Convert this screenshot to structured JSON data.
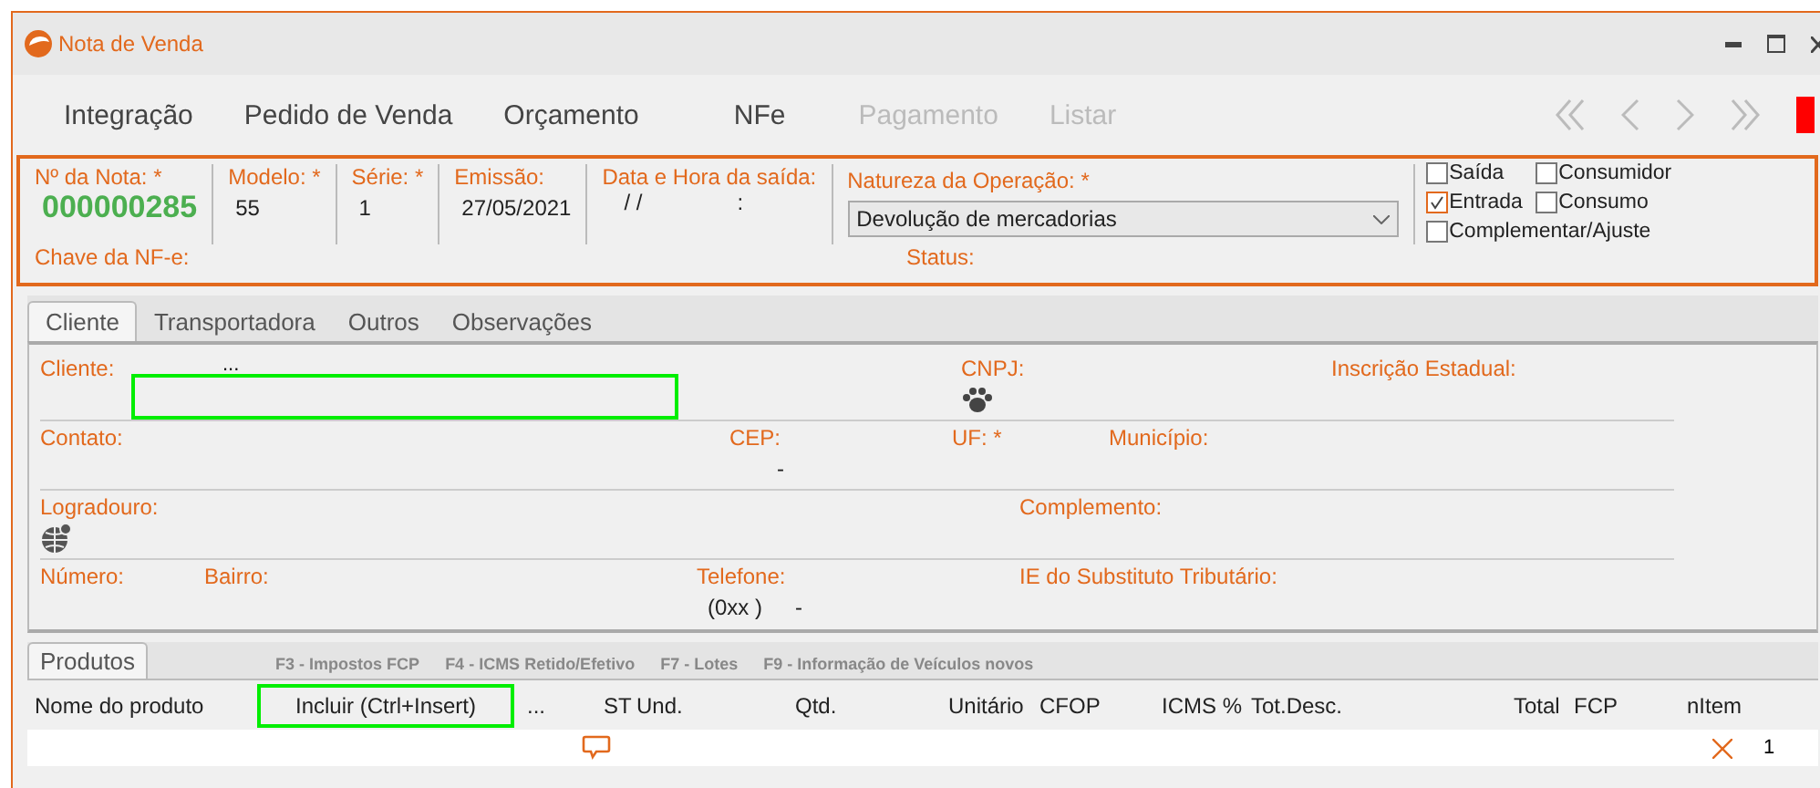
{
  "window": {
    "title": "Nota de Venda"
  },
  "toolbar": {
    "items": [
      {
        "label": "Integração",
        "disabled": false
      },
      {
        "label": "Pedido de Venda",
        "disabled": false
      },
      {
        "label": "Orçamento",
        "disabled": false
      },
      {
        "label": "NFe",
        "disabled": false
      },
      {
        "label": "Pagamento",
        "disabled": true
      },
      {
        "label": "Listar",
        "disabled": true
      }
    ]
  },
  "header": {
    "fields": [
      {
        "label": "Nº da Nota: *",
        "value": "000000285",
        "kind": "number"
      },
      {
        "label": "Modelo: *",
        "value": "55",
        "kind": "text"
      },
      {
        "label": "Série: *",
        "value": "1",
        "kind": "text"
      },
      {
        "label": "Emissão:",
        "value": "27/05/2021",
        "kind": "text"
      },
      {
        "label": "Data e Hora da saída:",
        "value": "/ /",
        "time": ":",
        "kind": "datetime"
      }
    ],
    "operation": {
      "label": "Natureza da Operação: *",
      "value": "Devolução de mercadorias"
    },
    "options": [
      {
        "label": "Saída",
        "checked": false
      },
      {
        "label": "Consumidor",
        "checked": false
      },
      {
        "label": "Entrada",
        "checked": true
      },
      {
        "label": "Consumo",
        "checked": false
      },
      {
        "label": "Complementar/Ajuste",
        "checked": false
      }
    ],
    "chave_label": "Chave da NF-e:",
    "status_label": "Status:"
  },
  "tabs": [
    {
      "label": "Cliente",
      "selected": true
    },
    {
      "label": "Transportadora",
      "selected": false
    },
    {
      "label": "Outros",
      "selected": false
    },
    {
      "label": "Observações",
      "selected": false
    }
  ],
  "client_rows": [
    [
      {
        "label": "Cliente:",
        "kind": "client",
        "value": "...",
        "highlighted": true
      },
      {
        "label": "CNPJ:",
        "kind": "paw"
      },
      {
        "label": "Inscrição Estadual:",
        "kind": "text"
      }
    ],
    [
      {
        "label": "Contato:",
        "kind": "text"
      },
      {
        "label": "CEP:",
        "kind": "text",
        "value": "-"
      },
      {
        "label": "UF: *",
        "kind": "text"
      },
      {
        "label": "Município:",
        "kind": "text"
      }
    ],
    [
      {
        "label": "Logradouro:",
        "kind": "globe"
      },
      {
        "label": "Complemento:",
        "kind": "text"
      }
    ],
    [
      {
        "label": "Número:",
        "kind": "text"
      },
      {
        "label": "Bairro:",
        "kind": "text"
      },
      {
        "label": "Telefone:",
        "kind": "phone",
        "value": "(0xx  )",
        "value2": "-"
      },
      {
        "label": "IE do Substituto Tributário:",
        "kind": "text"
      }
    ]
  ],
  "products": {
    "tab": "Produtos",
    "hints": [
      "F3 - Impostos FCP",
      "F4 - ICMS Retido/Efetivo",
      "F7 - Lotes",
      "F9 - Informação de Veículos novos"
    ],
    "columns": [
      {
        "label": "Nome do produto",
        "kind": "text"
      },
      {
        "label": "Incluir (Ctrl+Insert)",
        "kind": "button",
        "highlighted": true
      },
      {
        "label": "...",
        "kind": "text"
      },
      {
        "label": "ST",
        "kind": "text"
      },
      {
        "label": "Und.",
        "kind": "text"
      },
      {
        "label": "Qtd.",
        "kind": "text"
      },
      {
        "label": "Unitário",
        "kind": "text"
      },
      {
        "label": "CFOP",
        "kind": "text"
      },
      {
        "label": "ICMS %",
        "kind": "text"
      },
      {
        "label": "Tot.Desc.",
        "kind": "text"
      },
      {
        "label": "Total",
        "kind": "text"
      },
      {
        "label": "FCP",
        "kind": "text"
      },
      {
        "label": "nItem",
        "kind": "text"
      }
    ],
    "rows": [
      {
        "nitem": "1"
      }
    ]
  }
}
